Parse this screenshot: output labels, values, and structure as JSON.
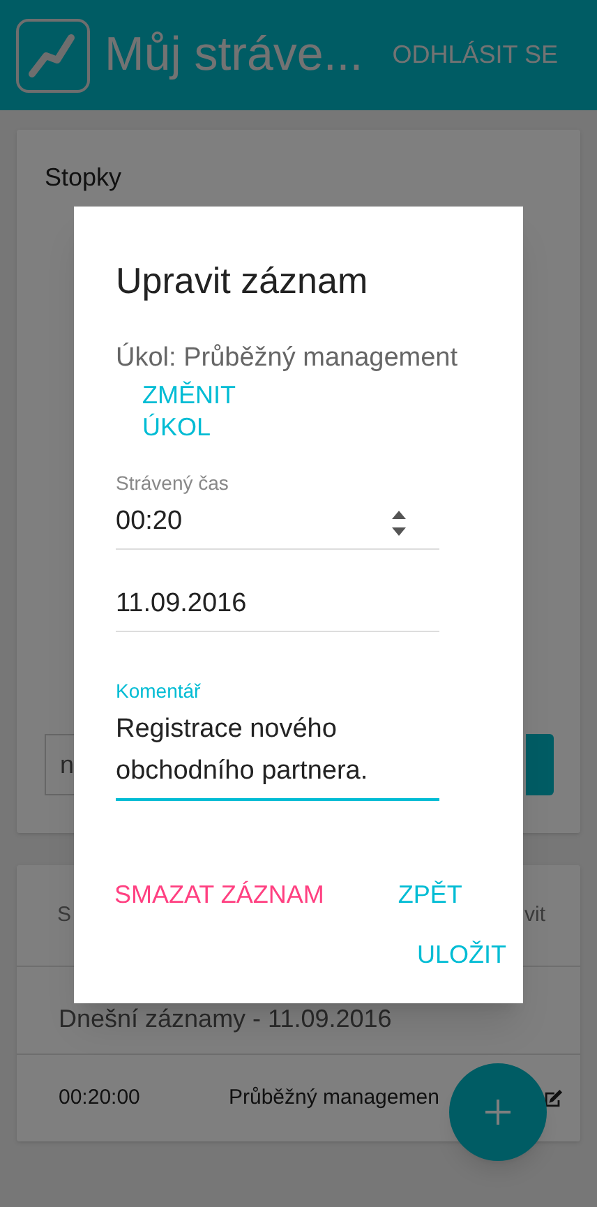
{
  "app_bar": {
    "title": "Můj stráve...",
    "logout": "ODHLÁSIT SE"
  },
  "stopwatch_card": {
    "title": "Stopky",
    "field_value": "n"
  },
  "records_card": {
    "columns": [
      "S",
      "vit"
    ],
    "group_title": "Dnešní záznamy - 11.09.2016",
    "rows": [
      {
        "time": "00:20:00",
        "task": "Průběžný managemen"
      }
    ]
  },
  "dialog": {
    "title": "Upravit záznam",
    "task_label": "Úkol: Průběžný management",
    "change_task": "ZMĚNIT ÚKOL",
    "time_field": {
      "label": "Strávený čas",
      "value": "00:20"
    },
    "date_field": {
      "value": "11.09.2016"
    },
    "comment_field": {
      "label": "Komentář",
      "value": "Registrace nového obchodního partnera.",
      "focused": true
    },
    "delete_button": "SMAZAT ZÁZNAM",
    "back_button": "ZPĚT",
    "save_button": "ULOŽIT"
  }
}
